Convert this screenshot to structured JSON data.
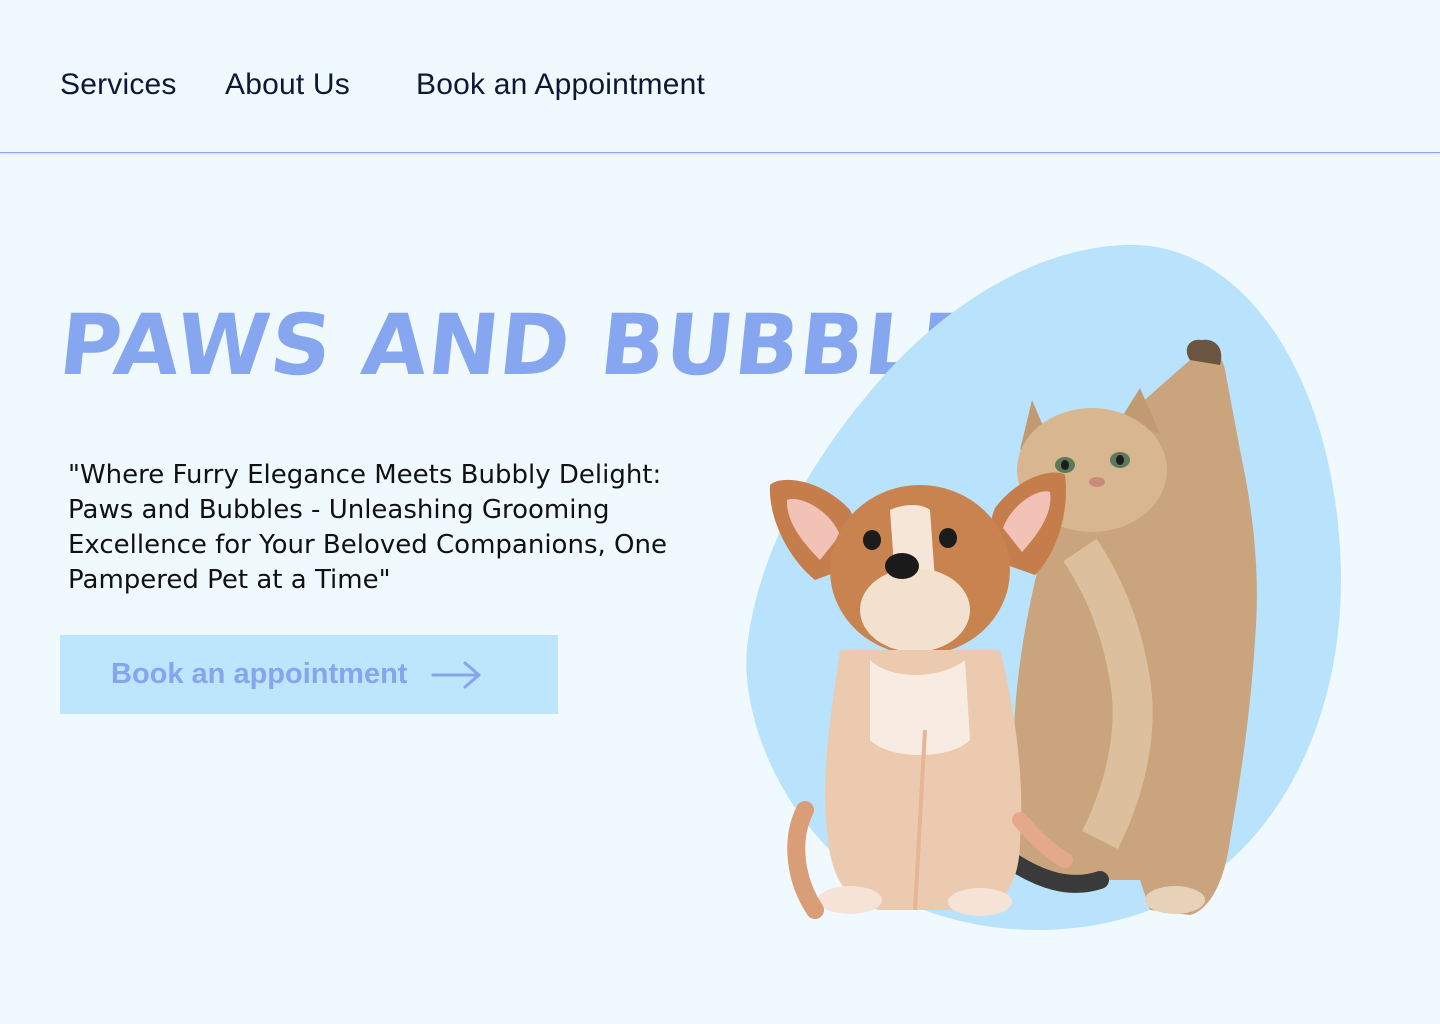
{
  "nav": {
    "services": "Services",
    "about": "About Us",
    "book": "Book an Appointment"
  },
  "hero": {
    "title": "PAWS AND BUBBLES",
    "tagline": "\"Where Furry Elegance Meets Bubbly Delight: Paws and Bubbles - Unleashing Grooming Excellence for Your Beloved Companions, One Pampered Pet at a Time\"",
    "cta_label": "Book an appointment",
    "cta_icon": "arrow-right-icon"
  },
  "colors": {
    "background": "#eff9fe",
    "accent": "#86a6ef",
    "blob": "#b9e3fc",
    "nav_text": "#0c1838"
  }
}
